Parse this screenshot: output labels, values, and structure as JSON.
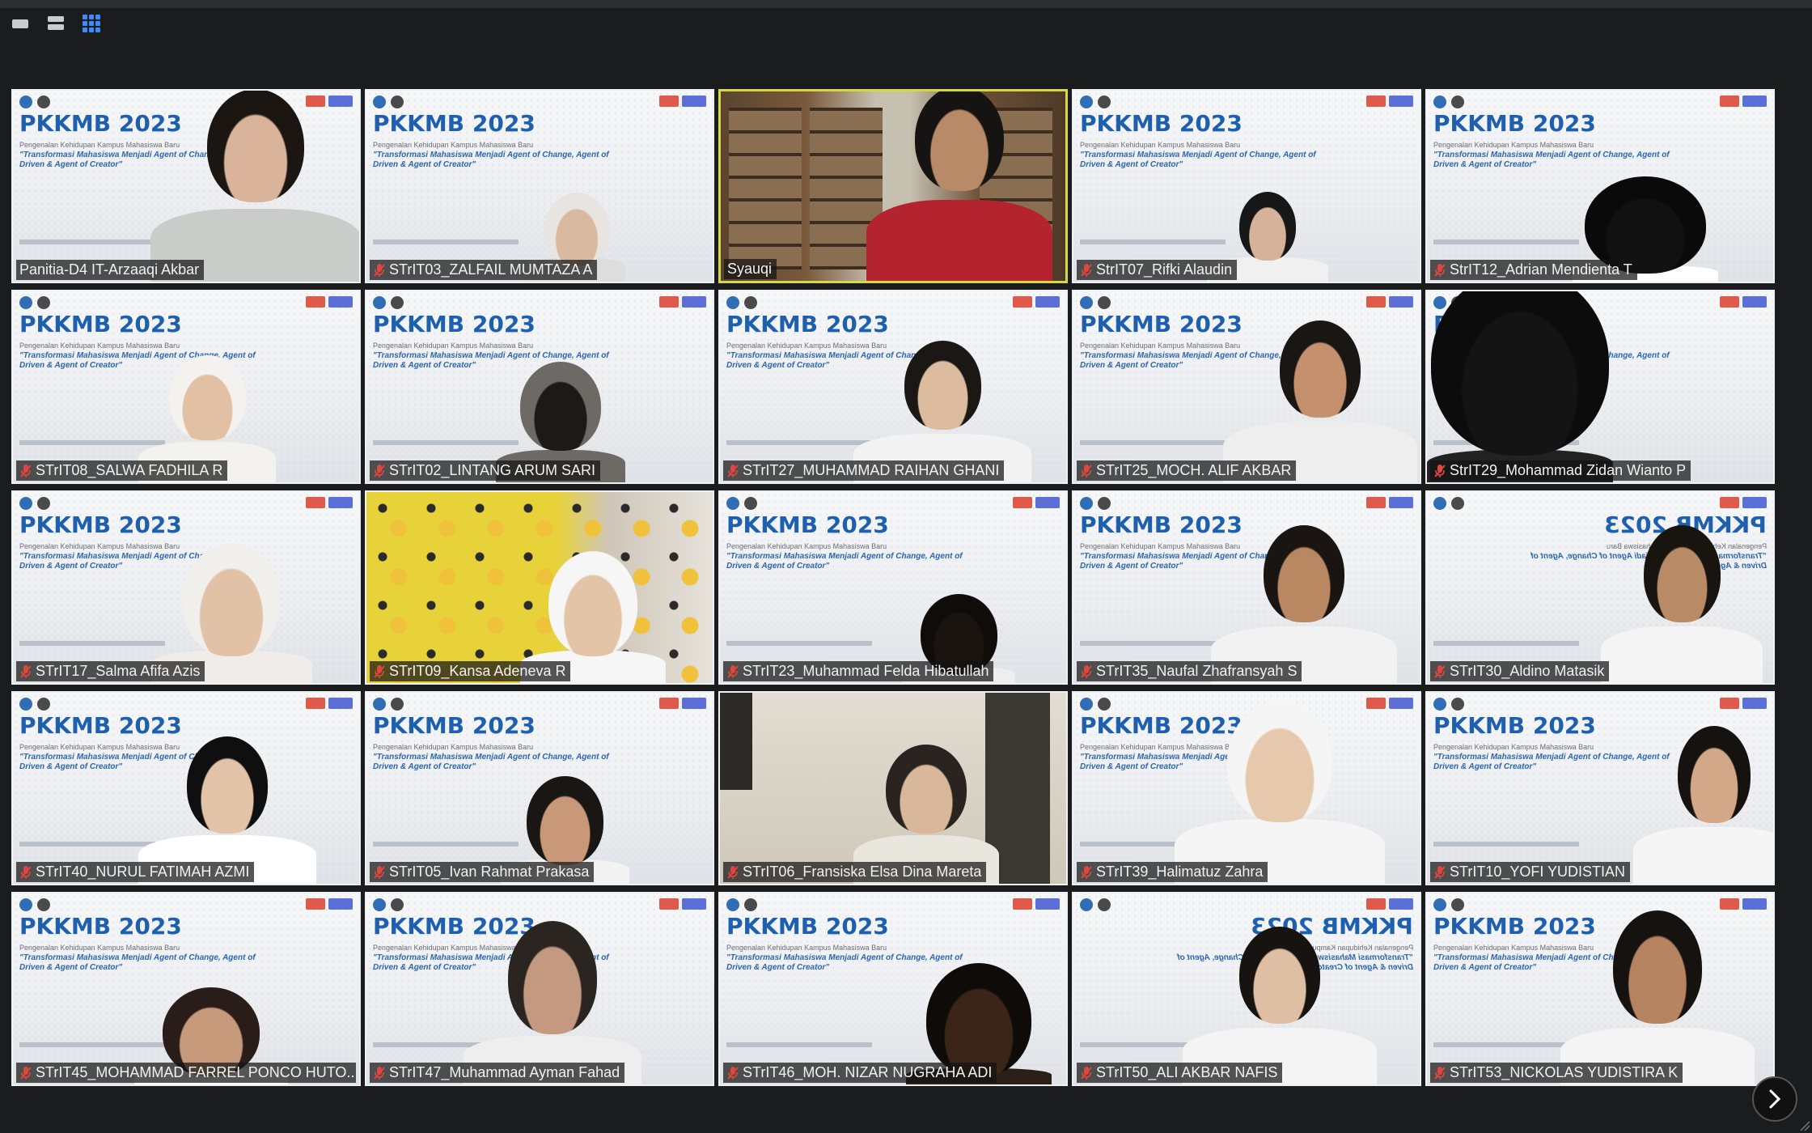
{
  "view_modes": [
    {
      "icon": "speaker-view-icon",
      "active": false
    },
    {
      "icon": "stacked-view-icon",
      "active": false
    },
    {
      "icon": "gallery-view-icon",
      "active": true
    }
  ],
  "slide": {
    "title": "PKKMB 2023",
    "subtitle": "Pengenalan Kehidupan Kampus Mahasiswa Baru",
    "tagline": "\"Transformasi Mahasiswa Menjadi Agent of Change, Agent of Driven & Agent of Creator\""
  },
  "participants": [
    {
      "name": "Panitia-D4 IT-Arzaaqi Akbar",
      "muted": false
    },
    {
      "name": "STrIT03_ZALFAIL MUMTAZA A",
      "muted": true
    },
    {
      "name": "Syauqi",
      "muted": false,
      "active_speaker": true
    },
    {
      "name": "StrIT07_Rifki Alaudin",
      "muted": true
    },
    {
      "name": "StrIT12_Adrian Mendienta T",
      "muted": true
    },
    {
      "name": "STrIT08_SALWA FADHILA R",
      "muted": true
    },
    {
      "name": "STrIT02_LINTANG ARUM SARI",
      "muted": true
    },
    {
      "name": "STrIT27_MUHAMMAD RAIHAN GHANI",
      "muted": true
    },
    {
      "name": "STrIT25_MOCH. ALIF AKBAR",
      "muted": true
    },
    {
      "name": "StrIT29_Mohammad Zidan Wianto P",
      "muted": true
    },
    {
      "name": "STrIT17_Salma Afifa Azis",
      "muted": true
    },
    {
      "name": "STrIT09_Kansa Adeneva R",
      "muted": true
    },
    {
      "name": "STrIT23_Muhammad Felda Hibatullah",
      "muted": true
    },
    {
      "name": "STrIT35_Naufal Zhafransyah S",
      "muted": true
    },
    {
      "name": "STrIT30_Aldino Matasik",
      "muted": true
    },
    {
      "name": "STrIT40_NURUL FATIMAH AZMI",
      "muted": true
    },
    {
      "name": "STrIT05_Ivan Rahmat Prakasa",
      "muted": true
    },
    {
      "name": "STrIT06_Fransiska Elsa Dina Mareta",
      "muted": true
    },
    {
      "name": "STrIT39_Halimatuz Zahra",
      "muted": true
    },
    {
      "name": "STrIT10_YOFI YUDISTIAN",
      "muted": true
    },
    {
      "name": "STrIT45_MOHAMMAD FARREL PONCO HUTO...",
      "muted": true
    },
    {
      "name": "STrIT47_Muhammad Ayman Fahad",
      "muted": true
    },
    {
      "name": "STrIT46_MOH. NIZAR NUGRAHA ADI",
      "muted": true
    },
    {
      "name": "STrIT50_ALI AKBAR NAFIS",
      "muted": true
    },
    {
      "name": "STrIT53_NICKOLAS YUDISTIRA K",
      "muted": true
    }
  ],
  "next_page_icon": "chevron-right-icon",
  "colors": {
    "background": "#1a1c1e",
    "active_border": "#d4d84a",
    "muted_mic": "#e0463b",
    "slide_title": "#1e5fae"
  }
}
